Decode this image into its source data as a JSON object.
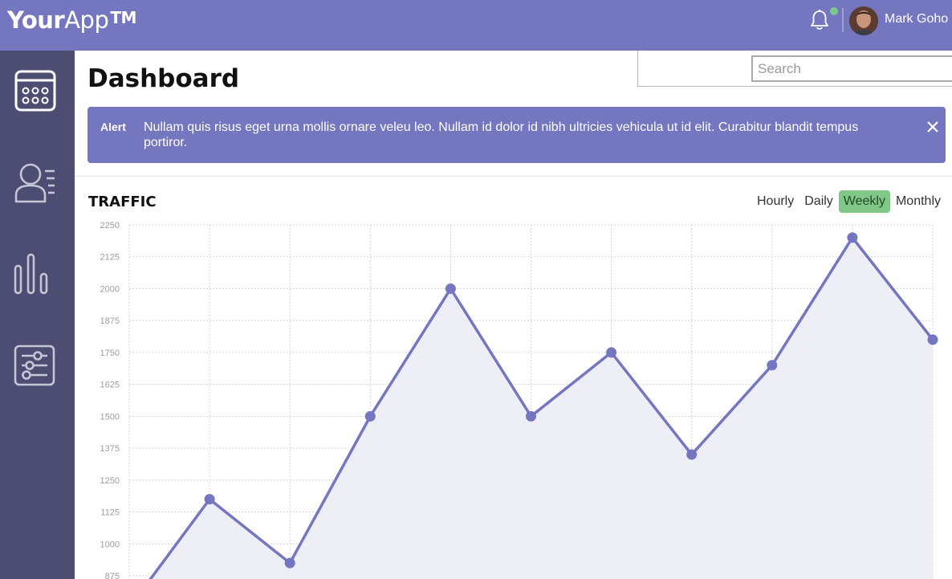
{
  "header": {
    "logo_strong": "Your",
    "logo_light": "App",
    "logo_tm": "TM",
    "user_name": "Mark Goho",
    "notification_icon": "bell-icon",
    "notification_dot_color": "#7bc98a"
  },
  "sidebar": {
    "items": [
      {
        "icon": "calendar-icon"
      },
      {
        "icon": "users-list-icon"
      },
      {
        "icon": "bar-chart-icon"
      },
      {
        "icon": "sliders-icon"
      }
    ]
  },
  "main": {
    "title": "Dashboard",
    "search": {
      "placeholder": "Search",
      "value": ""
    }
  },
  "alert": {
    "label": "Alert",
    "text": "Nullam quis risus eget urna mollis ornare veleu leo. Nullam id dolor id nibh ultricies vehicula ut id elit. Curabitur blandit tempus portiror.",
    "close_icon": "close-icon"
  },
  "traffic": {
    "title": "TRAFFIC",
    "tabs": [
      {
        "label": "Hourly",
        "active": false
      },
      {
        "label": "Daily",
        "active": false
      },
      {
        "label": "Weekly",
        "active": true
      },
      {
        "label": "Monthly",
        "active": false
      }
    ]
  },
  "colors": {
    "brand": "#7476bf",
    "sidebar": "#4d4c72",
    "active_tab": "#80c788",
    "line": "#7476bf",
    "fill": "#eeeef7"
  },
  "chart_data": {
    "type": "area",
    "title": "TRAFFIC",
    "y_ticks": [
      2250,
      2125,
      2000,
      1875,
      1750,
      1625,
      1500,
      1375,
      1250,
      1125,
      1000,
      875
    ],
    "ylim": [
      875,
      2250
    ],
    "x": [
      0,
      1,
      2,
      3,
      4,
      5,
      6,
      7,
      8,
      9,
      10
    ],
    "series": [
      {
        "values": [
          750,
          1175,
          925,
          1500,
          2000,
          1500,
          1750,
          1350,
          1700,
          2200,
          1800
        ]
      }
    ],
    "grid": true,
    "legend": "none"
  }
}
